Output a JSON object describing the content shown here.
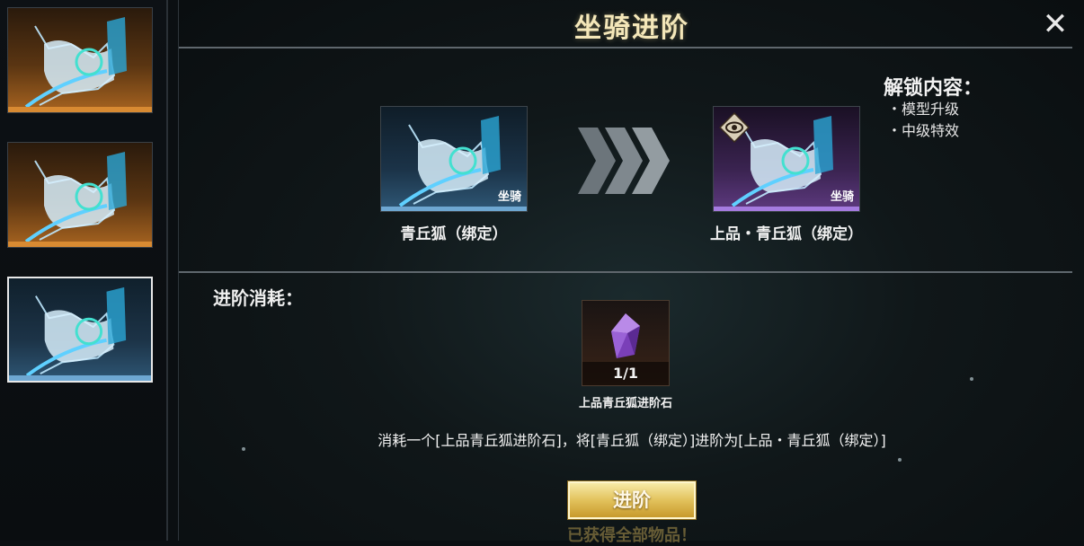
{
  "title": "坐骑进阶",
  "close_icon": "close-icon",
  "sidebar": {
    "items": [
      {
        "style": "gold",
        "icon": "fox-mount-icon"
      },
      {
        "style": "gold",
        "icon": "fox-mount-icon"
      },
      {
        "style": "blue",
        "icon": "fox-mount-icon",
        "selected": true
      }
    ]
  },
  "unlock": {
    "heading": "解锁内容：",
    "items": [
      "・模型升级",
      "・中级特效"
    ]
  },
  "from_mount": {
    "tag": "坐骑",
    "name": "青丘狐（绑定）",
    "color": "#2f5877"
  },
  "to_mount": {
    "tag": "坐骑",
    "name": "上品・青丘狐（绑定）",
    "color": "#5e3a80",
    "badge": "eye-icon"
  },
  "cost": {
    "label": "进阶消耗：",
    "item_count": "1/1",
    "item_name": "上品青丘狐进阶石"
  },
  "description": "消耗一个[上品青丘狐进阶石]，将[青丘狐（绑定）]进阶为[上品・青丘狐（绑定）]",
  "advance_button": "进阶",
  "footer_text": "已获得全部物品！",
  "colors": {
    "title": "#f4e7b9",
    "button": "#e2c25c",
    "accent_blue": "#6ea7d2",
    "accent_purple": "#a57be0"
  }
}
